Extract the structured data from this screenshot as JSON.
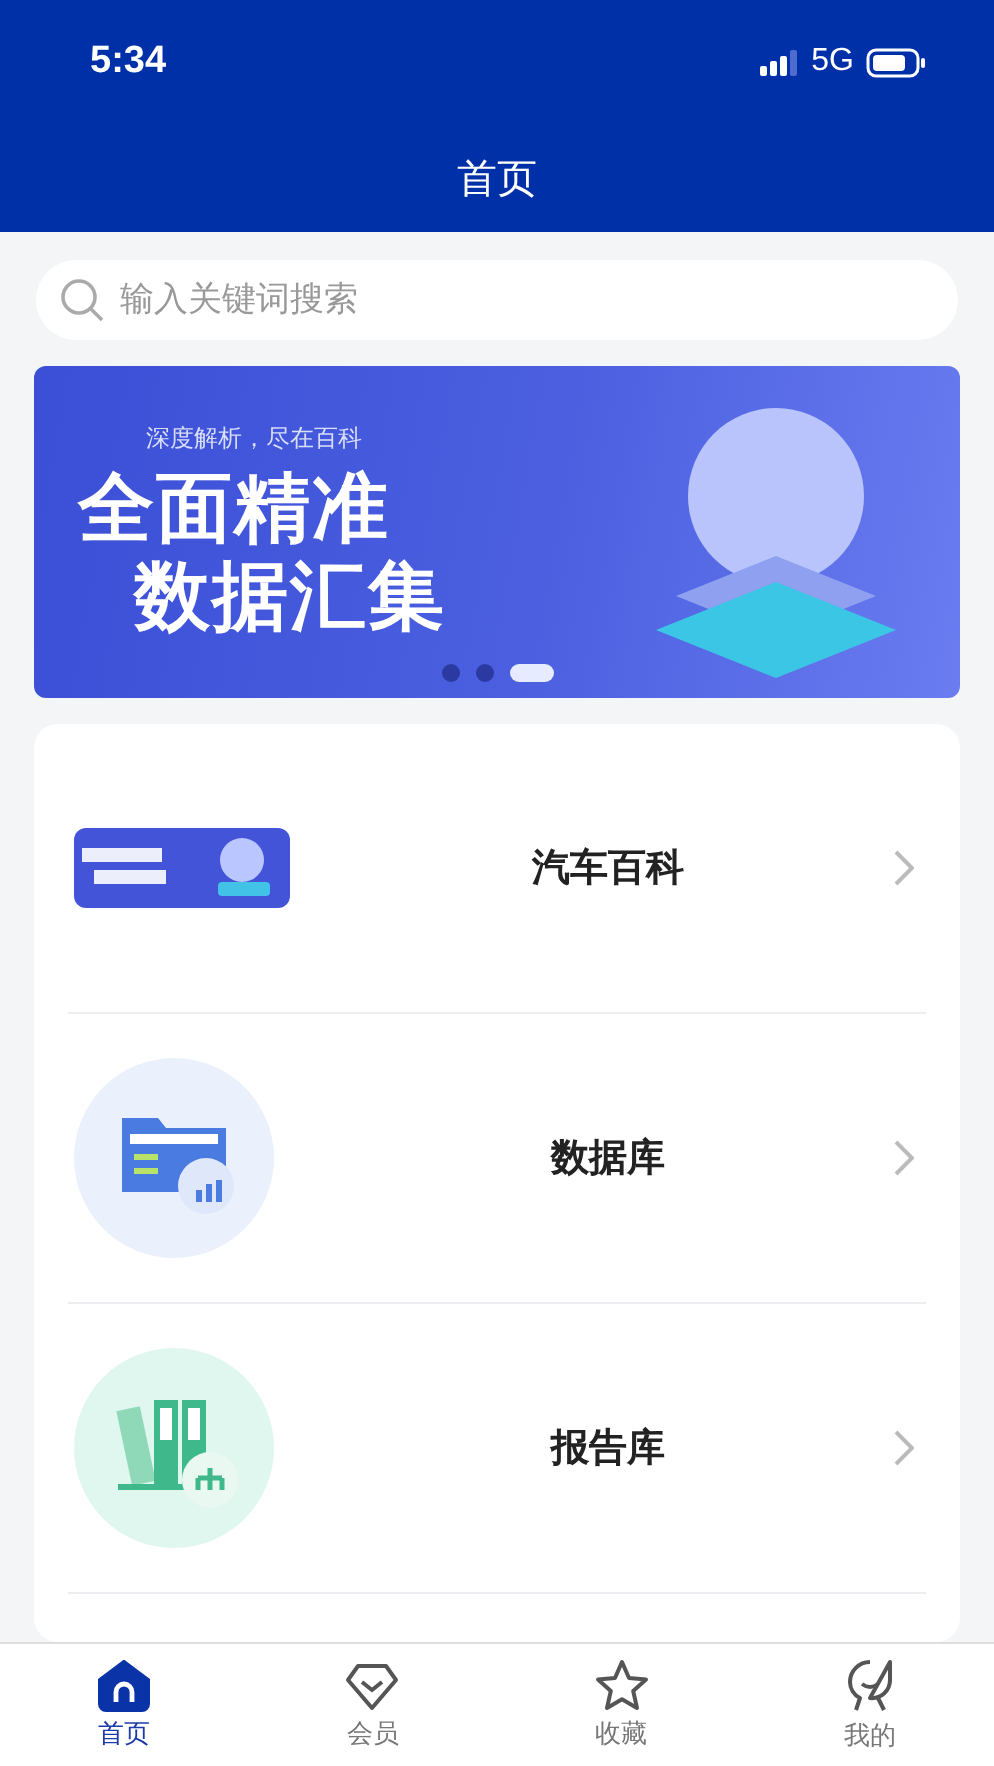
{
  "status_bar": {
    "time": "5:34",
    "network": "5G"
  },
  "nav_bar": {
    "title": "首页"
  },
  "search": {
    "placeholder": "输入关键词搜索"
  },
  "banner": {
    "tagline": "深度解析，尽在百科",
    "headline_1": "全面精准",
    "headline_2": "数据汇集",
    "dots": [
      {
        "selected": false
      },
      {
        "selected": false
      },
      {
        "selected": true
      }
    ]
  },
  "menu": [
    {
      "kind": "thumbnail",
      "label": "汽车百科"
    },
    {
      "kind": "database",
      "label": "数据库"
    },
    {
      "kind": "report",
      "label": "报告库"
    },
    {
      "kind": "partial"
    }
  ],
  "tab_bar": [
    {
      "kind": "home",
      "label": "首页",
      "selected": true
    },
    {
      "kind": "member",
      "label": "会员",
      "selected": false
    },
    {
      "kind": "favorite",
      "label": "收藏",
      "selected": false
    },
    {
      "kind": "mine",
      "label": "我的",
      "selected": false
    }
  ]
}
